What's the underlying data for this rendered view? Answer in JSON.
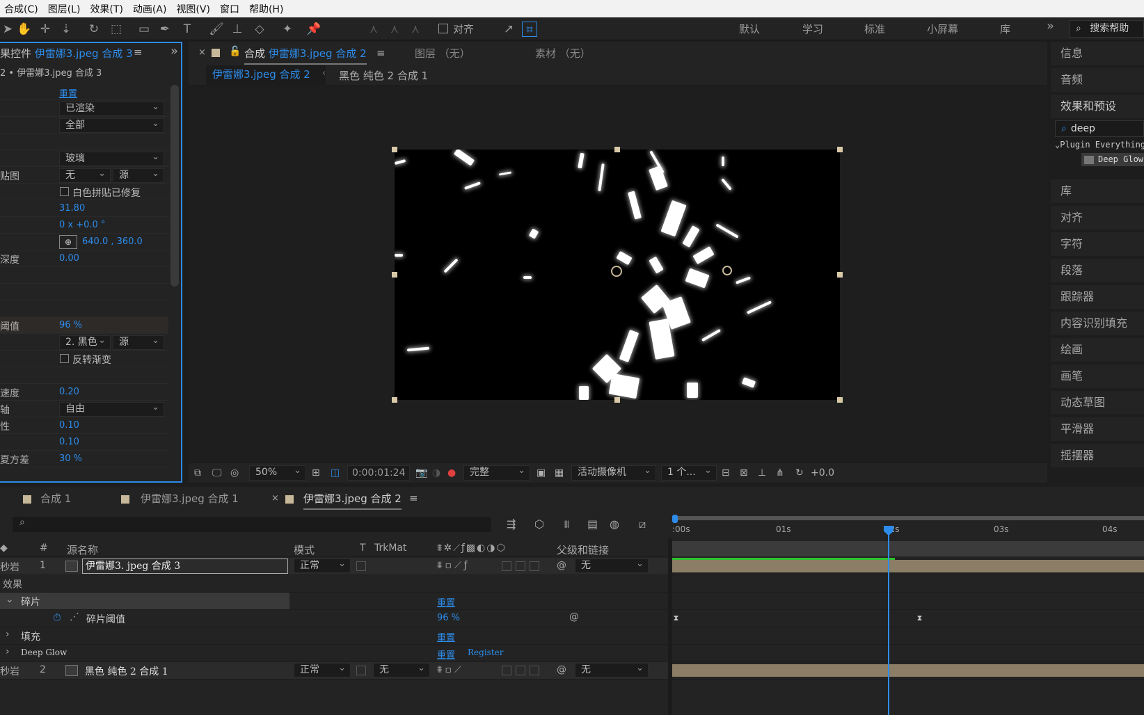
{
  "menu": [
    "合成(C)",
    "图层(L)",
    "效果(T)",
    "动画(A)",
    "视图(V)",
    "窗口",
    "帮助(H)"
  ],
  "toolbar": {
    "align_label": "对齐",
    "workspaces": [
      "默认",
      "学习",
      "标准",
      "小屏幕",
      "库"
    ],
    "more": "»",
    "help_search": "搜索帮助"
  },
  "effect_controls": {
    "title_prefix": "果控件",
    "title_comp": "伊雷娜3.jpeg 合成 3",
    "subtitle": "2 • 伊雷娜3.jpeg 合成 3",
    "rows": [
      {
        "label": "",
        "reset": "重置"
      },
      {
        "label": "",
        "dropdown": "已渲染"
      },
      {
        "label": "",
        "dropdown": "全部"
      },
      {
        "label": "",
        "dropdown": "玻璃"
      },
      {
        "label": "贴图",
        "dropdown": "无",
        "dropdown2": "源"
      },
      {
        "label": "",
        "checkbox": "白色拼贴已修复"
      },
      {
        "label": "",
        "value": "31.80"
      },
      {
        "label": "",
        "value": "0 x +0.0 °"
      },
      {
        "label": "",
        "value": "640.0 , 360.0"
      },
      {
        "label": "深度",
        "value": "0.00"
      },
      {
        "label": "阈值",
        "value": "96 %"
      },
      {
        "label": "",
        "dropdown": "2. 黑色",
        "dropdown2": "源"
      },
      {
        "label": "",
        "checkbox": "反转渐变"
      },
      {
        "label": "速度",
        "value": "0.20"
      },
      {
        "label": "轴",
        "dropdown": "自由"
      },
      {
        "label": "性",
        "value": "0.10"
      },
      {
        "label": "",
        "value": "0.10"
      },
      {
        "label": "夏方差",
        "value": "30 %"
      }
    ]
  },
  "viewer": {
    "tab_comp_label": "合成",
    "tab_comp_name": "伊雷娜3.jpeg 合成 2",
    "tab_layer": "图层  （无）",
    "tab_footage": "素材  （无）",
    "breadcrumb_active": "伊雷娜3.jpeg 合成 2",
    "breadcrumb_next": "黑色 纯色 2 合成 1",
    "zoom": "50%",
    "timecode": "0:00:01:24",
    "resolution": "完整",
    "camera": "活动摄像机",
    "views": "1 个...",
    "exposure": "+0.0"
  },
  "right_panels": [
    "信息",
    "音频",
    "效果和预设",
    "库",
    "对齐",
    "字符",
    "段落",
    "跟踪器",
    "内容识别填充",
    "绘画",
    "画笔",
    "动态草图",
    "平滑器",
    "摇摆器"
  ],
  "effects_search": {
    "query": "deep",
    "category": "Plugin Everything",
    "item": "Deep Glow"
  },
  "timeline": {
    "tabs": [
      "合成 1",
      "伊雷娜3.jpeg 合成 1",
      "伊雷娜3.jpeg 合成 2"
    ],
    "headers": {
      "num": "#",
      "source": "源名称",
      "mode": "模式",
      "t": "T",
      "trkmat": "TrkMat",
      "parent": "父级和链接"
    },
    "ruler": [
      ":00s",
      "01s",
      "02s",
      "03s",
      "04s"
    ],
    "layers": [
      {
        "num": "1",
        "name": "伊雷娜3. jpeg  合成  3",
        "mode": "正常",
        "parent": "无",
        "cut": "秒岩"
      },
      {
        "num": "2",
        "name": "黑色  纯色  2  合成  1",
        "mode": "正常",
        "trkmat": "无",
        "parent": "无",
        "cut": "秒岩"
      }
    ],
    "effects_label": "效果",
    "fx_shatter": "碎片",
    "fx_shatter_param": "碎片阈值",
    "fx_shatter_value": "96 %",
    "fx_fill": "填充",
    "fx_deepglow": "Deep Glow",
    "reset": "重置",
    "register": "Register"
  }
}
